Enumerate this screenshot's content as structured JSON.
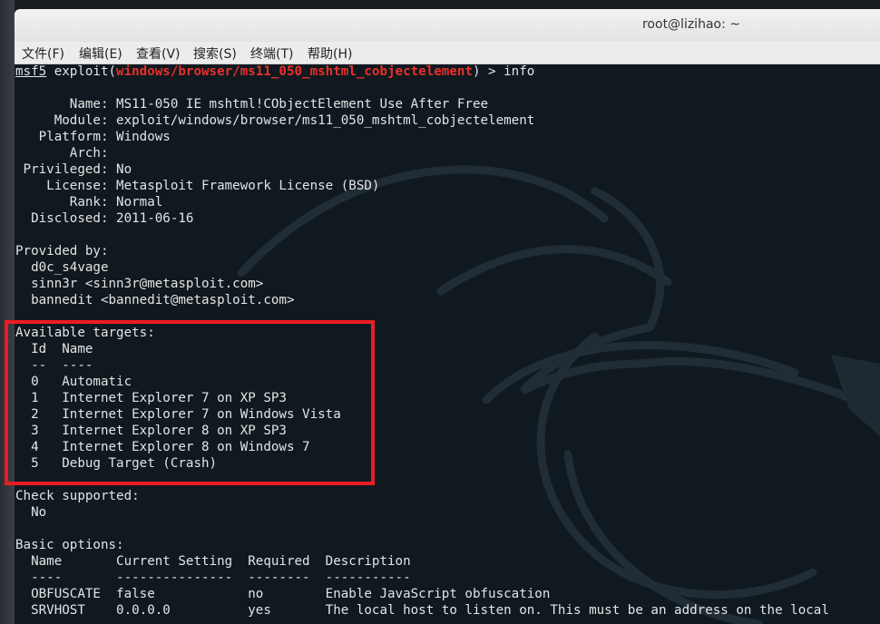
{
  "window": {
    "title": "root@lizihao: ~"
  },
  "menubar": [
    "文件(F)",
    "编辑(E)",
    "查看(V)",
    "搜索(S)",
    "终端(T)",
    "帮助(H)"
  ],
  "prompt": {
    "msf": "msf5",
    "exploit_open": " exploit(",
    "module": "windows/browser/ms11_050_mshtml_cobjectelement",
    "close_cmd": ") > info"
  },
  "info": {
    "name": "       Name: MS11-050 IE mshtml!CObjectElement Use After Free",
    "module": "     Module: exploit/windows/browser/ms11_050_mshtml_cobjectelement",
    "platform": "   Platform: Windows",
    "arch": "       Arch: ",
    "privileged": " Privileged: No",
    "license": "    License: Metasploit Framework License (BSD)",
    "rank": "       Rank: Normal",
    "disclosed": "  Disclosed: 2011-06-16"
  },
  "provided": {
    "header": "Provided by:",
    "authors": [
      "  d0c_s4vage",
      "  sinn3r <sinn3r@metasploit.com>",
      "  bannedit <bannedit@metasploit.com>"
    ]
  },
  "targets": {
    "header": "Available targets:",
    "col_header": "  Id  Name",
    "col_sep": "  --  ----",
    "rows": [
      "  0   Automatic",
      "  1   Internet Explorer 7 on XP SP3",
      "  2   Internet Explorer 7 on Windows Vista",
      "  3   Internet Explorer 8 on XP SP3",
      "  4   Internet Explorer 8 on Windows 7",
      "  5   Debug Target (Crash)"
    ]
  },
  "check": {
    "header": "Check supported:",
    "value": "  No"
  },
  "options": {
    "header": "Basic options:",
    "col_header": "  Name       Current Setting  Required  Description",
    "col_sep": "  ----       ---------------  --------  -----------",
    "rows": [
      "  OBFUSCATE  false            no        Enable JavaScript obfuscation",
      "  SRVHOST    0.0.0.0          yes       The local host to listen on. This must be an address on the local"
    ]
  },
  "colors": {
    "terminal_bg": "#10191f",
    "text": "#e4e4e4",
    "module_red": "#e8302a",
    "highlight_red": "#ec1c24"
  }
}
